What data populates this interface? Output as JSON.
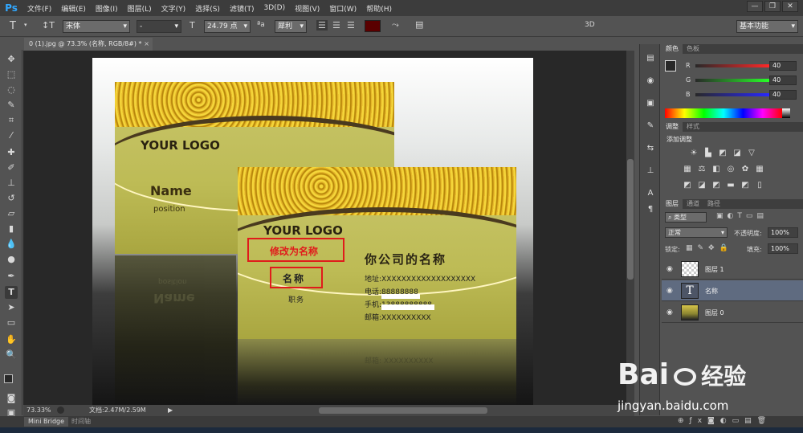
{
  "app": {
    "logo": "Ps",
    "menu": [
      "文件(F)",
      "编辑(E)",
      "图像(I)",
      "图层(L)",
      "文字(Y)",
      "选择(S)",
      "滤镜(T)",
      "3D(D)",
      "视图(V)",
      "窗口(W)",
      "帮助(H)"
    ],
    "window_controls": [
      "—",
      "❐",
      "✕"
    ]
  },
  "options": {
    "font_family": "宋体",
    "font_style": "-",
    "font_size": "24.79 点",
    "aa_label": "ªa",
    "aa_mode": "犀利",
    "mode_3d": "3D",
    "workspace": "基本功能",
    "text_color": "#5a0000"
  },
  "document": {
    "tab_title": "0 (1).jpg @ 73.3% (名称, RGB/8#) *",
    "zoom": "73.33%",
    "doc_size": "文档:2.47M/2.59M"
  },
  "card_back": {
    "logo": "YOUR LOGO",
    "name": "Name",
    "position": "position"
  },
  "card_front": {
    "logo": "YOUR LOGO",
    "annotation": "修改为名称",
    "name": "名称",
    "title": "职务",
    "company": "你公司的名称",
    "fields": [
      {
        "label": "地址:",
        "value": "XXXXXXXXXXXXXXXXXXX"
      },
      {
        "label": "电话:",
        "value": "88888888"
      },
      {
        "label": "手机:",
        "value": "13888888888"
      },
      {
        "label": "邮箱:",
        "value": "XXXXXXXXXX"
      }
    ]
  },
  "color_panel": {
    "tabs": [
      "颜色",
      "色板"
    ],
    "rows": [
      {
        "label": "R",
        "value": "40"
      },
      {
        "label": "G",
        "value": "40"
      },
      {
        "label": "B",
        "value": "40"
      }
    ]
  },
  "adjust_panel": {
    "tabs": [
      "调整",
      "样式"
    ],
    "title": "添加调整"
  },
  "layers_panel": {
    "tabs": [
      "图层",
      "通道",
      "路径"
    ],
    "filter": "类型",
    "blend_mode": "正常",
    "opacity_label": "不透明度:",
    "opacity": "100%",
    "lock_label": "锁定:",
    "fill_label": "填充:",
    "fill": "100%",
    "layers": [
      {
        "name": "图层 1",
        "selected": false
      },
      {
        "name": "名称",
        "selected": true
      },
      {
        "name": "图层 0",
        "selected": false
      }
    ]
  },
  "bottom_tabs": [
    "Mini Bridge",
    "时间轴"
  ],
  "watermark": {
    "brand": "Bai",
    "brand2": "经验",
    "url": "jingyan.baidu.com"
  }
}
